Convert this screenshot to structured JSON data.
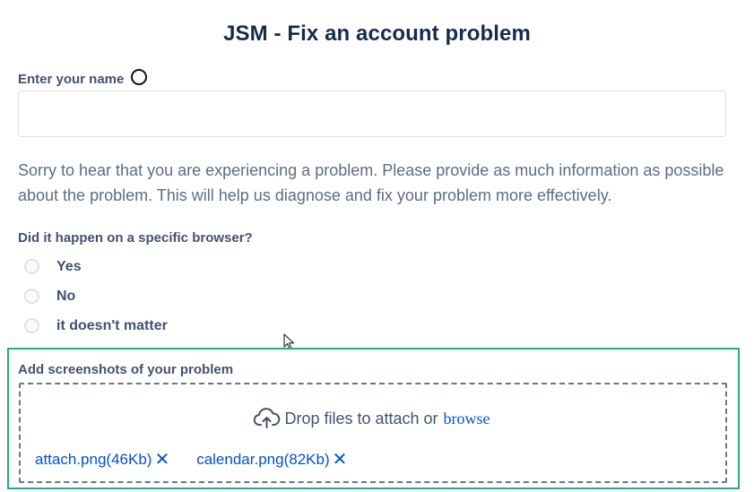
{
  "form": {
    "title": "JSM - Fix an account problem",
    "name_field": {
      "label": "Enter your name",
      "value": "",
      "placeholder": ""
    },
    "description": "Sorry to hear that you are experiencing a problem. Please provide as much information as possible about the problem. This will help us diagnose and fix your problem more effectively.",
    "browser_question": {
      "label": "Did it happen on a specific browser?",
      "options": [
        {
          "label": "Yes",
          "selected": false
        },
        {
          "label": "No",
          "selected": false
        },
        {
          "label": "it doesn't matter",
          "selected": false
        }
      ]
    },
    "attachments": {
      "label": "Add screenshots of your problem",
      "drop_text": "Drop files to attach or",
      "browse_label": "browse",
      "upload_icon": "cloud-upload-icon",
      "files": [
        {
          "name": "attach.png",
          "size": "(46Kb)",
          "remove_icon": "close-icon"
        },
        {
          "name": "calendar.png",
          "size": "(82Kb)",
          "remove_icon": "close-icon"
        }
      ]
    }
  },
  "colors": {
    "heading": "#172b4d",
    "label": "#42526e",
    "body_text": "#5e6c84",
    "link": "#0052cc",
    "highlight_border": "#2aa98a",
    "input_border": "#dfe1e6"
  }
}
